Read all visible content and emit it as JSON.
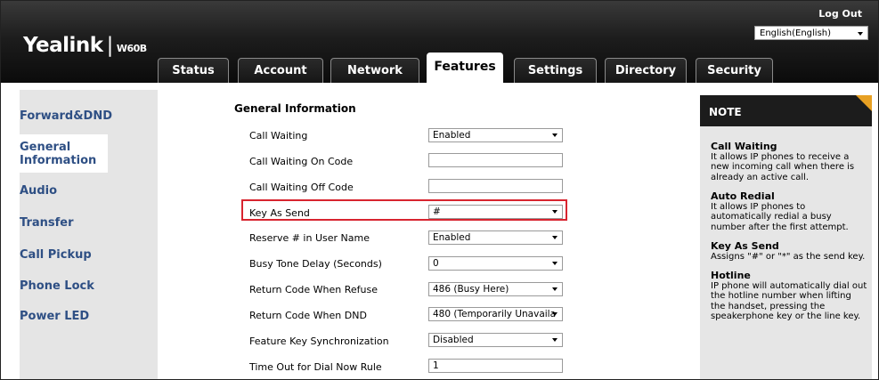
{
  "header": {
    "logo": "Yealink",
    "logo_sep": "|",
    "model": "W60B",
    "logout": "Log Out",
    "language": "English(English)"
  },
  "tabs": [
    {
      "label": "Status"
    },
    {
      "label": "Account"
    },
    {
      "label": "Network"
    },
    {
      "label": "Features",
      "active": true
    },
    {
      "label": "Settings"
    },
    {
      "label": "Directory"
    },
    {
      "label": "Security"
    }
  ],
  "sidebar": {
    "items": [
      {
        "label": "Forward&DND"
      },
      {
        "label": "General Information",
        "active": true
      },
      {
        "label": "Audio"
      },
      {
        "label": "Transfer"
      },
      {
        "label": "Call Pickup"
      },
      {
        "label": "Phone Lock"
      },
      {
        "label": "Power LED"
      }
    ]
  },
  "main": {
    "section_title": "General Information",
    "rows": [
      {
        "label": "Call Waiting",
        "value": "Enabled",
        "type": "select"
      },
      {
        "label": "Call Waiting On Code",
        "value": "",
        "type": "input"
      },
      {
        "label": "Call Waiting Off Code",
        "value": "",
        "type": "input"
      },
      {
        "label": "Key As Send",
        "value": "#",
        "type": "select",
        "highlighted": true
      },
      {
        "label": "Reserve # in User Name",
        "value": "Enabled",
        "type": "select"
      },
      {
        "label": "Busy Tone Delay (Seconds)",
        "value": "0",
        "type": "select"
      },
      {
        "label": "Return Code When Refuse",
        "value": "486 (Busy Here)",
        "type": "select"
      },
      {
        "label": "Return Code When DND",
        "value": "480 (Temporarily Unavaila",
        "type": "select"
      },
      {
        "label": "Feature Key Synchronization",
        "value": "Disabled",
        "type": "select"
      },
      {
        "label": "Time Out for Dial Now Rule",
        "value": "1",
        "type": "input"
      }
    ]
  },
  "note": {
    "title": "NOTE",
    "blocks": [
      {
        "heading": "Call Waiting",
        "text": "It allows IP phones to receive a new incoming call when there is already an active call."
      },
      {
        "heading": "Auto Redial",
        "text": "It allows IP phones to automatically redial a busy number after the first attempt."
      },
      {
        "heading": "Key As Send",
        "text": "Assigns \"#\" or \"*\" as the send key."
      },
      {
        "heading": "Hotline",
        "text": "IP phone will automatically dial out the hotline number when lifting the handset, pressing the speakerphone key or the line key."
      }
    ]
  },
  "colors": {
    "sidebar_text": "#2e4f84",
    "highlight_border": "#d8242f",
    "note_corner": "#e7a023"
  }
}
